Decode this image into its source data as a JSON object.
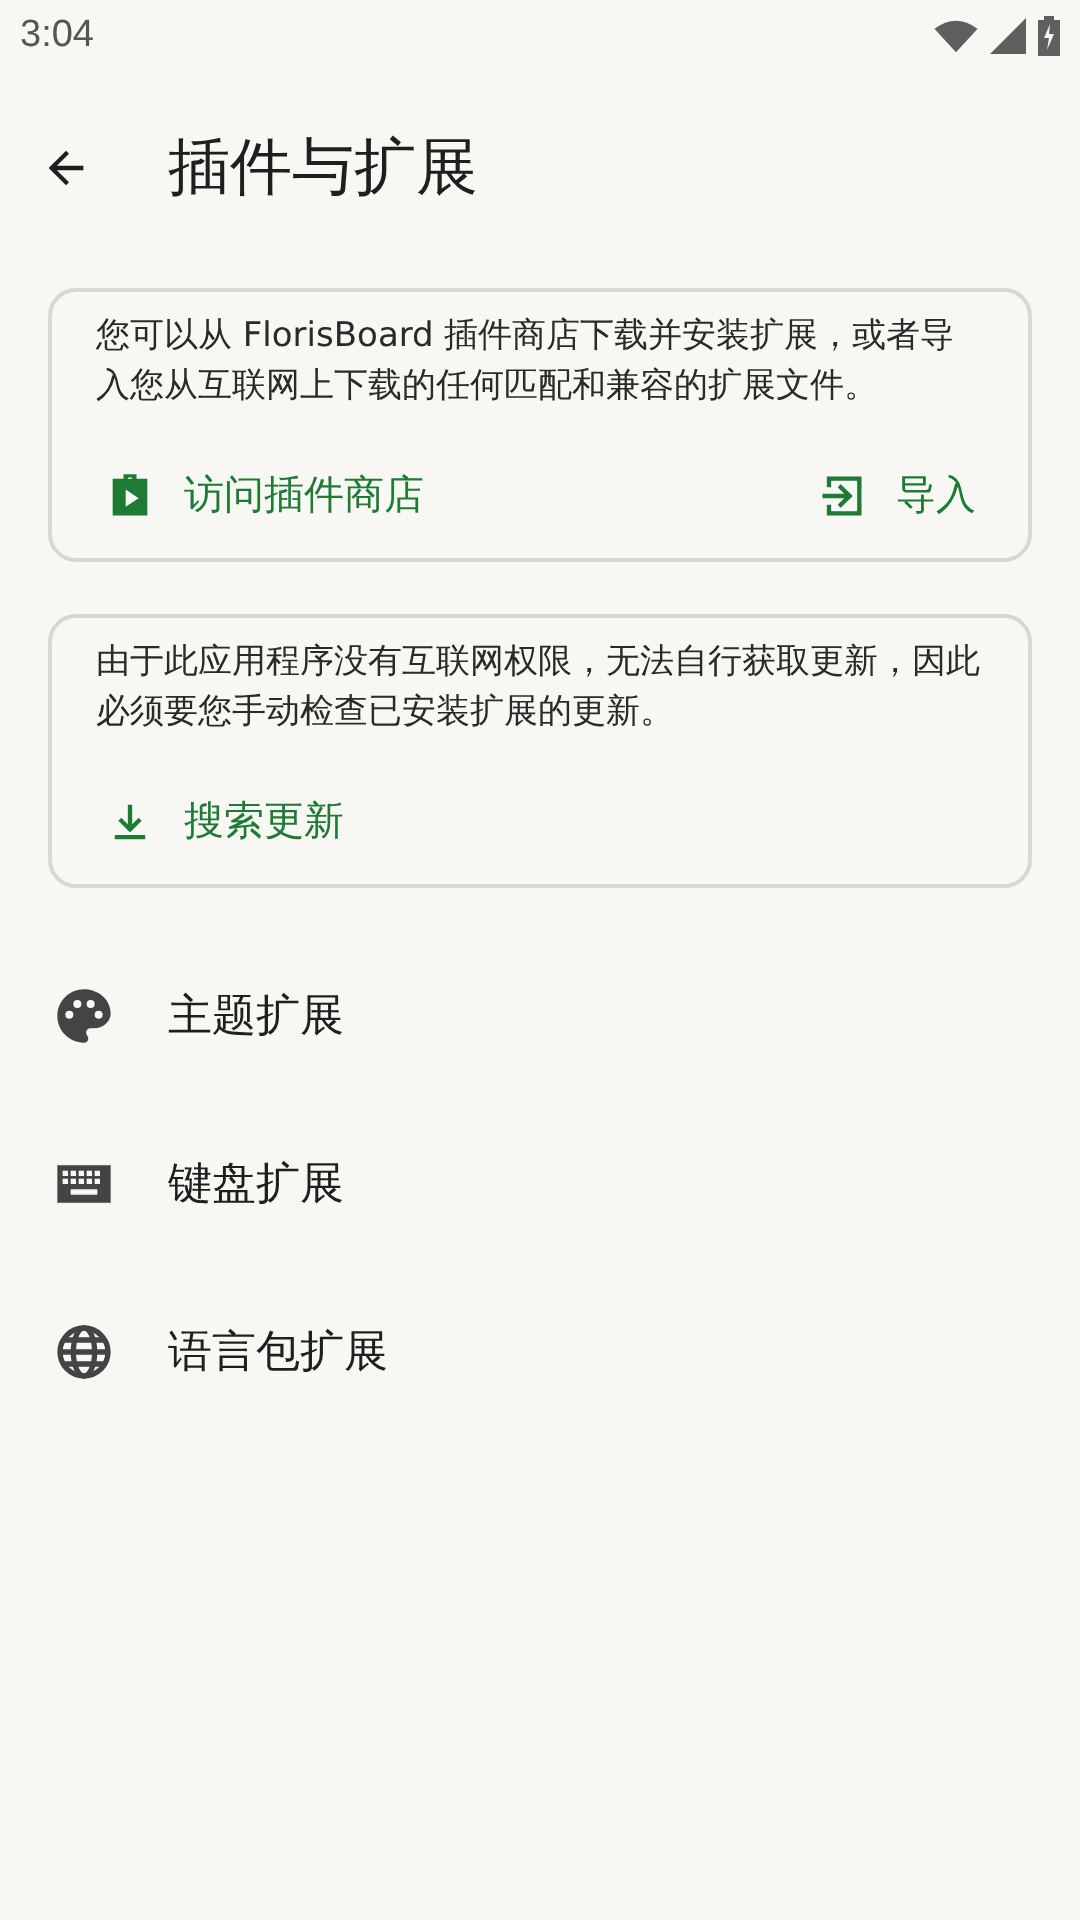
{
  "status_bar": {
    "time": "3:04"
  },
  "app_bar": {
    "title": "插件与扩展"
  },
  "cards": [
    {
      "text": "您可以从 FlorisBoard 插件商店下载并安装扩展，或者导入您从互联网上下载的任何匹配和兼容的扩展文件。",
      "actions": [
        {
          "kind": "store",
          "label": "访问插件商店"
        },
        {
          "kind": "import",
          "label": "导入"
        }
      ]
    },
    {
      "text": "由于此应用程序没有互联网权限，无法自行获取更新，因此必须要您手动检查已安装扩展的更新。",
      "actions": [
        {
          "kind": "download",
          "label": "搜索更新"
        }
      ]
    }
  ],
  "items": [
    {
      "kind": "palette",
      "label": "主题扩展"
    },
    {
      "kind": "keyboard",
      "label": "键盘扩展"
    },
    {
      "kind": "globe",
      "label": "语言包扩展"
    }
  ]
}
